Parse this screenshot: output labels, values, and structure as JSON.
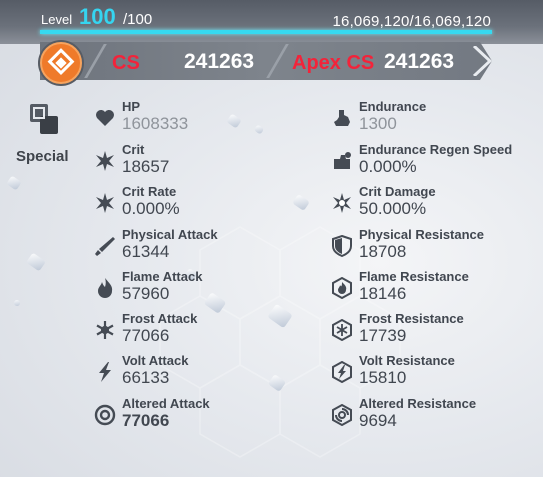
{
  "level": {
    "label": "Level",
    "value": "100",
    "max": "/100",
    "experience": "16,069,120/16,069,120"
  },
  "cs": {
    "label": "CS",
    "value": "241263",
    "apex_label": "Apex CS",
    "apex_value": "241263",
    "logo_color": "#ef7a2a",
    "label_color": "#f3233a"
  },
  "special": {
    "label": "Special"
  },
  "left_stats": [
    {
      "name": "HP",
      "value": "1608333",
      "icon": "heart-icon"
    },
    {
      "name": "Crit",
      "value": "18657",
      "icon": "crit-star-icon"
    },
    {
      "name": "Crit Rate",
      "value": "0.000%",
      "icon": "crit-rate-icon"
    },
    {
      "name": "Physical Attack",
      "value": "61344",
      "icon": "sword-icon"
    },
    {
      "name": "Flame Attack",
      "value": "57960",
      "icon": "flame-icon"
    },
    {
      "name": "Frost Attack",
      "value": "77066",
      "icon": "frost-icon"
    },
    {
      "name": "Volt Attack",
      "value": "66133",
      "icon": "volt-icon"
    },
    {
      "name": "Altered Attack",
      "value": "77066",
      "icon": "altered-icon"
    }
  ],
  "right_stats": [
    {
      "name": "Endurance",
      "value": "1300",
      "icon": "endurance-icon"
    },
    {
      "name": "Endurance Regen Speed",
      "value": "0.000%",
      "icon": "regen-icon"
    },
    {
      "name": "Crit Damage",
      "value": "50.000%",
      "icon": "crit-damage-icon"
    },
    {
      "name": "Physical Resistance",
      "value": "18708",
      "icon": "physical-shield-icon"
    },
    {
      "name": "Flame Resistance",
      "value": "18146",
      "icon": "flame-shield-icon"
    },
    {
      "name": "Frost Resistance",
      "value": "17739",
      "icon": "frost-shield-icon"
    },
    {
      "name": "Volt Resistance",
      "value": "15810",
      "icon": "volt-shield-icon"
    },
    {
      "name": "Altered Resistance",
      "value": "9694",
      "icon": "altered-shield-icon"
    }
  ]
}
